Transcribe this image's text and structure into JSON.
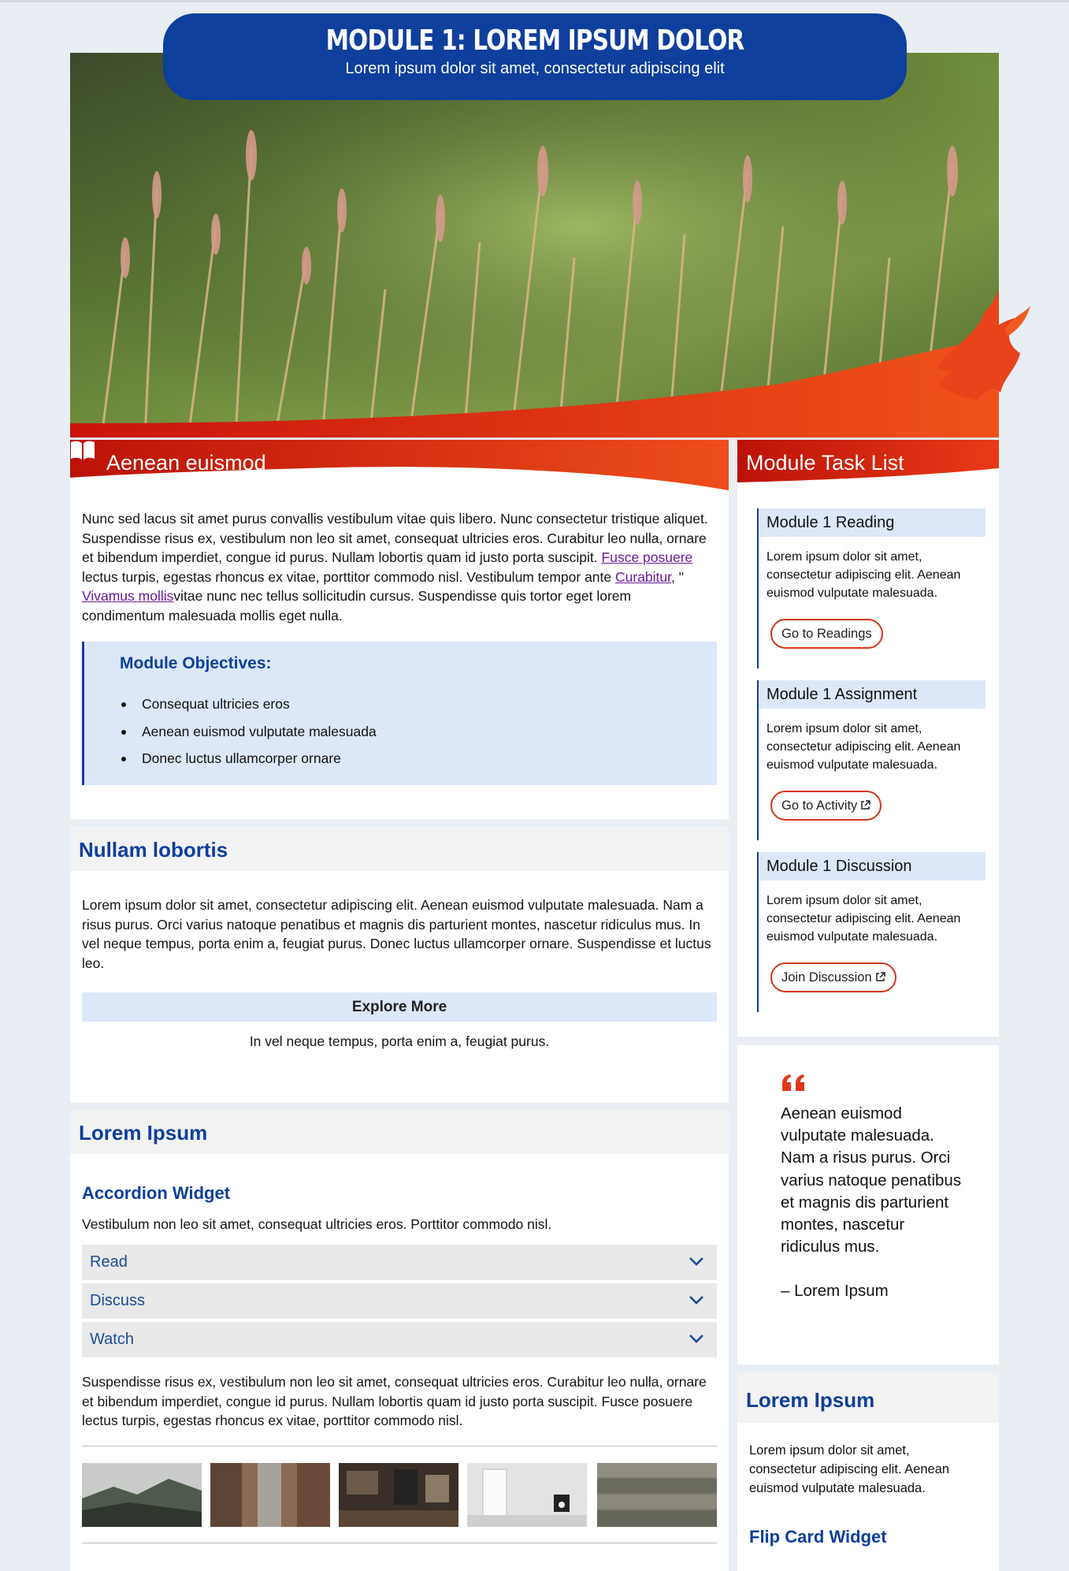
{
  "header": {
    "title": "MODULE 1: LOREM IPSUM DOLOR",
    "subtitle": "Lorem ipsum dolor sit amet, consectetur adipiscing elit"
  },
  "colors": {
    "brand_blue": "#0e3f9c",
    "accent_red": "#d6361a",
    "light_blue": "#dce8f8"
  },
  "intro": {
    "heading": "Aenean euismod",
    "paragraph_part1": "Nunc sed lacus sit amet purus convallis vestibulum vitae quis libero. Nunc consectetur tristique aliquet. Suspendisse risus ex, vestibulum non leo sit amet, consequat ultricies eros. Curabitur leo nulla, ornare et bibendum imperdiet, congue id purus. Nullam lobortis quam id justo porta suscipit. ",
    "link1": "Fusce posuere",
    "paragraph_part2": " lectus turpis, egestas rhoncus ex vitae, porttitor commodo nisl. Vestibulum tempor ante ",
    "link2": "Curabitur",
    "paragraph_part3": ", \" ",
    "link3": "Vivamus mollis",
    "paragraph_part4": "vitae nunc nec tellus sollicitudin cursus. Suspendisse quis tortor eget lorem condimentum malesuada mollis eget nulla.",
    "objectives_title": "Module Objectives:",
    "objectives": [
      "Consequat ultricies eros",
      "Aenean euismod vulputate malesuada",
      "Donec luctus ullamcorper ornare"
    ]
  },
  "nullam": {
    "heading": "Nullam lobortis",
    "paragraph": "Lorem ipsum dolor sit amet, consectetur adipiscing elit. Aenean euismod vulputate malesuada. Nam a risus purus. Orci varius natoque penatibus et magnis dis parturient montes, nascetur ridiculus mus. In vel neque tempus, porta enim a, feugiat purus. Donec luctus ullamcorper ornare. Suspendisse et luctus leo.",
    "explore_label": "Explore More",
    "explore_text": "In vel neque tempus, porta enim a, feugiat purus."
  },
  "lorem": {
    "heading": "Lorem Ipsum",
    "accordion_title": "Accordion Widget",
    "accordion_intro": "Vestibulum non leo sit amet, consequat ultricies eros. Porttitor commodo nisl.",
    "accordion_items": [
      "Read",
      "Discuss",
      "Watch"
    ],
    "paragraph": "Suspendisse risus ex, vestibulum non leo sit amet, consequat ultricies eros. Curabitur leo nulla, ornare et bibendum imperdiet, congue id purus. Nullam lobortis quam id justo porta suscipit. Fusce posuere lectus turpis, egestas rhoncus ex vitae, porttitor commodo nisl."
  },
  "tasks": {
    "heading": "Module Task List",
    "items": [
      {
        "title": "Module 1 Reading",
        "text": "Lorem ipsum dolor sit amet, consectetur adipiscing elit. Aenean euismod vulputate malesuada.",
        "button": "Go to Readings"
      },
      {
        "title": "Module 1 Assignment",
        "text": "Lorem ipsum dolor sit amet, consectetur adipiscing elit. Aenean euismod vulputate malesuada.",
        "button": "Go to Activity"
      },
      {
        "title": "Module 1 Discussion",
        "text": "Lorem ipsum dolor sit amet, consectetur adipiscing elit. Aenean euismod vulputate malesuada.",
        "button": "Join Discussion"
      }
    ]
  },
  "quote": {
    "text": "Aenean euismod vulputate malesuada. Nam a risus purus. Orci varius natoque penatibus et magnis dis parturient montes, nascetur ridiculus mus.",
    "author": "– Lorem Ipsum"
  },
  "sidebar_lorem": {
    "heading": "Lorem Ipsum",
    "paragraph": "Lorem ipsum dolor sit amet, consectetur adipiscing elit. Aenean euismod vulputate malesuada.",
    "flip_title": "Flip Card Widget"
  }
}
